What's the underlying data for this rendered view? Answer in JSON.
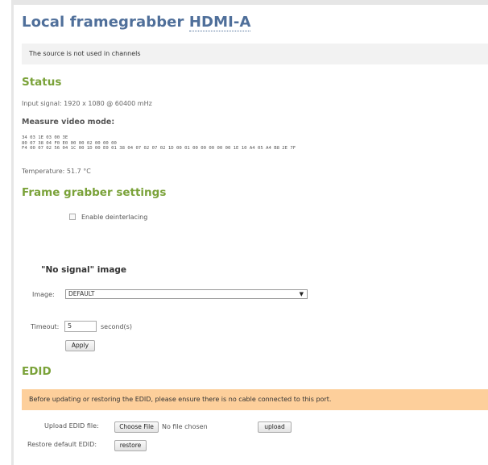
{
  "title": {
    "prefix": "Local framegrabber",
    "source": "HDMI-A"
  },
  "notice_top": "The source is not used in channels",
  "status": {
    "heading": "Status",
    "input_signal": "Input signal: 1920 x 1080 @ 60400 mHz",
    "measure_heading": "Measure video mode:",
    "measure_lines": [
      "34 03 1E 03 00 3E",
      "80 07 38 04 F0 E0 00 00 02 00 00 00",
      "F4 00 07 02 56 04 1C 00 1D 00 E0 01 38 04 07 02 07 02 1D 00 01 00 00 00 00 00 1E 10 A4 05 A4 B8 2E 7F"
    ],
    "temperature": "Temperature: 51.7 °C"
  },
  "frame_grabber": {
    "heading": "Frame grabber settings",
    "deinterlace_label": "Enable deinterlacing",
    "deinterlace_checked": false,
    "no_signal_heading": "\"No signal\" image",
    "image_label": "Image:",
    "image_value": "DEFAULT",
    "timeout_label": "Timeout:",
    "timeout_value": "5",
    "timeout_unit": "second(s)",
    "apply_label": "Apply"
  },
  "edid": {
    "heading": "EDID",
    "warning": "Before updating or restoring the EDID, please ensure there is no cable connected to this port.",
    "upload_label": "Upload EDID file:",
    "choose_file_label": "Choose File",
    "no_file_text": "No file chosen",
    "upload_button": "upload",
    "restore_label": "Restore default EDID:",
    "restore_button": "restore"
  },
  "colors": {
    "title": "#4f6f9a",
    "section_heading": "#7aa239",
    "warning_bg": "#fdcf9b",
    "notice_bg": "#f2f2f2"
  }
}
